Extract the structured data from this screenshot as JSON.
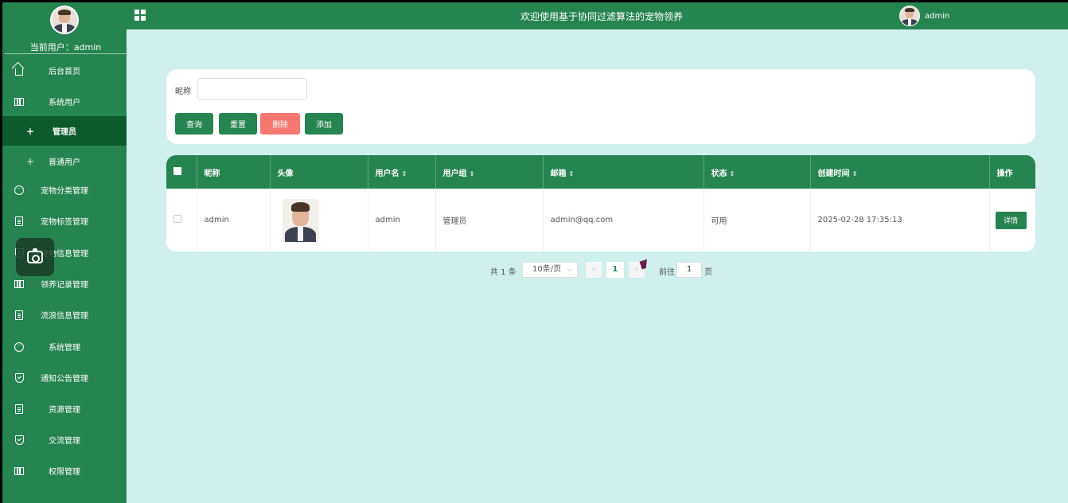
{
  "header": {
    "title": "欢迎使用基于协同过滤算法的宠物领养",
    "username": "admin"
  },
  "sidebar": {
    "current_user": "当前用户：admin",
    "items": [
      {
        "label": "后台首页",
        "icon": "home-icon"
      },
      {
        "label": "系统用户",
        "icon": "columns-icon"
      },
      {
        "label": "管理员",
        "icon": "plus-icon",
        "sub": true,
        "active": true
      },
      {
        "label": "普通用户",
        "icon": "plus-icon",
        "sub": true
      },
      {
        "label": "宠物分类管理",
        "icon": "chat-icon"
      },
      {
        "label": "宠物标签管理",
        "icon": "document-icon"
      },
      {
        "label": "宠物信息管理",
        "icon": "shield-icon"
      },
      {
        "label": "领养记录管理",
        "icon": "columns-icon"
      },
      {
        "label": "流浪信息管理",
        "icon": "document-icon"
      },
      {
        "label": "系统管理",
        "icon": "chat-icon"
      },
      {
        "label": "通知公告管理",
        "icon": "shield-icon"
      },
      {
        "label": "资源管理",
        "icon": "document-icon"
      },
      {
        "label": "交流管理",
        "icon": "shield-icon"
      },
      {
        "label": "权限管理",
        "icon": "columns-icon"
      }
    ]
  },
  "search": {
    "nickname_label": "昵称",
    "nickname_value": "",
    "buttons": {
      "query": "查询",
      "reset": "重置",
      "delete": "删除",
      "add": "添加"
    }
  },
  "table": {
    "headers": {
      "nickname": "昵称",
      "avatar": "头像",
      "username": "用户名",
      "group": "用户组",
      "email": "邮箱",
      "status": "状态",
      "created": "创建时间",
      "actions": "操作"
    },
    "sort_symbol": "⇕",
    "rows": [
      {
        "nickname": "admin",
        "username": "admin",
        "group": "管理员",
        "email": "admin@qq.com",
        "status": "可用",
        "created": "2025-02-28 17:35:13",
        "action": "详情"
      }
    ]
  },
  "pagination": {
    "total": "共 1 条",
    "page_size": "10条/页",
    "current_page": "1",
    "goto_label": "前往",
    "goto_value": "1",
    "page_suffix": "页"
  },
  "colors": {
    "primary": "#268451",
    "active_menu": "#0c5a2d",
    "danger": "#f57770",
    "main_bg": "#cff0ed"
  }
}
